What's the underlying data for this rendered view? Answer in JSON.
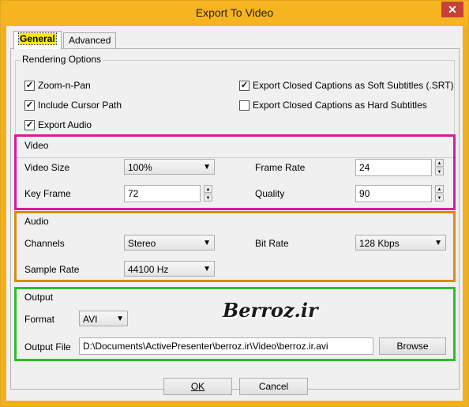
{
  "window": {
    "title": "Export To Video",
    "close_glyph": "✕"
  },
  "tabs": [
    {
      "label": "General"
    },
    {
      "label": "Advanced"
    }
  ],
  "rendering": {
    "title": "Rendering Options",
    "options": [
      {
        "label": "Zoom-n-Pan",
        "checked": true
      },
      {
        "label": "Include Cursor Path",
        "checked": true
      },
      {
        "label": "Export Audio",
        "checked": true
      },
      {
        "label": "Export Closed Captions as Soft Subtitles (.SRT)",
        "checked": true
      },
      {
        "label": "Export Closed Captions as Hard Subtitles",
        "checked": false
      }
    ]
  },
  "video": {
    "title": "Video",
    "size_label": "Video Size",
    "size_value": "100%",
    "keyframe_label": "Key Frame",
    "keyframe_value": "72",
    "framerate_label": "Frame Rate",
    "framerate_value": "24",
    "quality_label": "Quality",
    "quality_value": "90"
  },
  "audio": {
    "title": "Audio",
    "channels_label": "Channels",
    "channels_value": "Stereo",
    "samplerate_label": "Sample Rate",
    "samplerate_value": "44100 Hz",
    "bitrate_label": "Bit Rate",
    "bitrate_value": "128 Kbps"
  },
  "output": {
    "title": "Output",
    "format_label": "Format",
    "format_value": "AVI",
    "file_label": "Output File",
    "file_value": "D:\\Documents\\ActivePresenter\\berroz.ir\\Video\\berroz.ir.avi",
    "browse_label": "Browse"
  },
  "footer": {
    "ok_label": "OK",
    "cancel_label": "Cancel"
  },
  "watermark": "Berroz.ir",
  "colors": {
    "video_frame": "#d81b9a",
    "audio_frame": "#d98b14",
    "output_frame": "#2cbf2c",
    "tab_highlight": "#ffeb00"
  }
}
